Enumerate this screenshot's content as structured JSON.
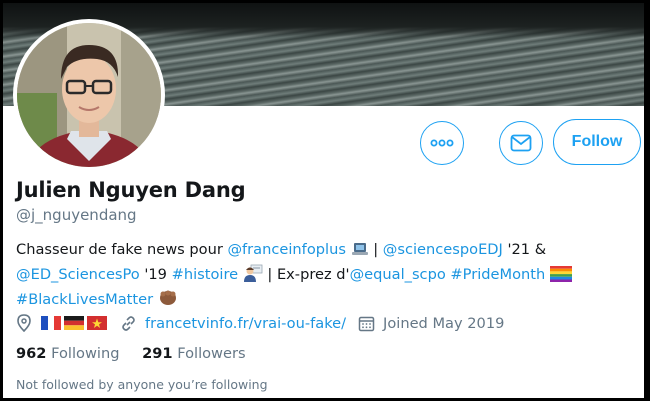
{
  "profile": {
    "name": "Julien Nguyen Dang",
    "handle": "@j_nguyendang",
    "follow_label": "Follow",
    "more_icon": "more-dots-icon",
    "message_icon": "envelope-icon"
  },
  "bio": {
    "text1": "Chasseur de fake news pour ",
    "mention1": "@franceinfoplus",
    "text2": " | ",
    "mention2": "@sciencespoEDJ",
    "text3": " '21 &",
    "mention3": "@ED_SciencesPo",
    "text4": " '19 ",
    "hashtag1": "#histoire",
    "text5": " | Ex-prez d'",
    "mention4": "@equal_scpo",
    "text6": " ",
    "hashtag2": "#PrideMonth",
    "hashtag3": "#BlackLivesMatter"
  },
  "meta": {
    "location_icon": "location-pin-icon",
    "flags": [
      "France",
      "Germany",
      "Vietnam"
    ],
    "url": "francetvinfo.fr/vrai-ou-fake/",
    "joined": "Joined May 2019"
  },
  "stats": {
    "following_count": "962",
    "following_label": "Following",
    "followers_count": "291",
    "followers_label": "Followers"
  },
  "footnote": "Not followed by anyone you’re following",
  "colors": {
    "accent": "#1da1f2",
    "link": "#1b95e0",
    "muted": "#657786",
    "text": "#14171a"
  }
}
